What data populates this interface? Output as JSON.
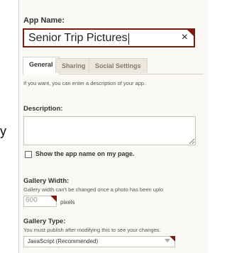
{
  "edge_glyph": "y",
  "app_name": {
    "label": "App Name:",
    "value": "Senior Trip Pictures",
    "clear_glyph": "×"
  },
  "tabs": [
    {
      "label": "General",
      "active": true
    },
    {
      "label": "Sharing",
      "active": false
    },
    {
      "label": "Social Settings",
      "active": false
    }
  ],
  "general": {
    "intro_hint": "If you want, you can enter a description of your app.",
    "description_label": "Description:",
    "description_value": "",
    "show_name_label": "Show the app name on my page.",
    "show_name_checked": false,
    "gallery_width": {
      "label": "Gallery Width:",
      "hint": "Gallery width can't be changed once a photo has been uplo",
      "value": "600",
      "unit": "pixels"
    },
    "gallery_type": {
      "label": "Gallery Type:",
      "hint": "You must publish after modifying this to see your changes.",
      "selected": "JavaScript (Recommended)"
    }
  },
  "colors": {
    "accent": "#7b1d0e",
    "panel_bg": "#fbf9f6",
    "tab_inactive_text": "#8a7a66"
  },
  "icons": {
    "clear": "close-icon",
    "dropdown": "chevron-down-icon",
    "checkbox": "checkbox-icon"
  }
}
